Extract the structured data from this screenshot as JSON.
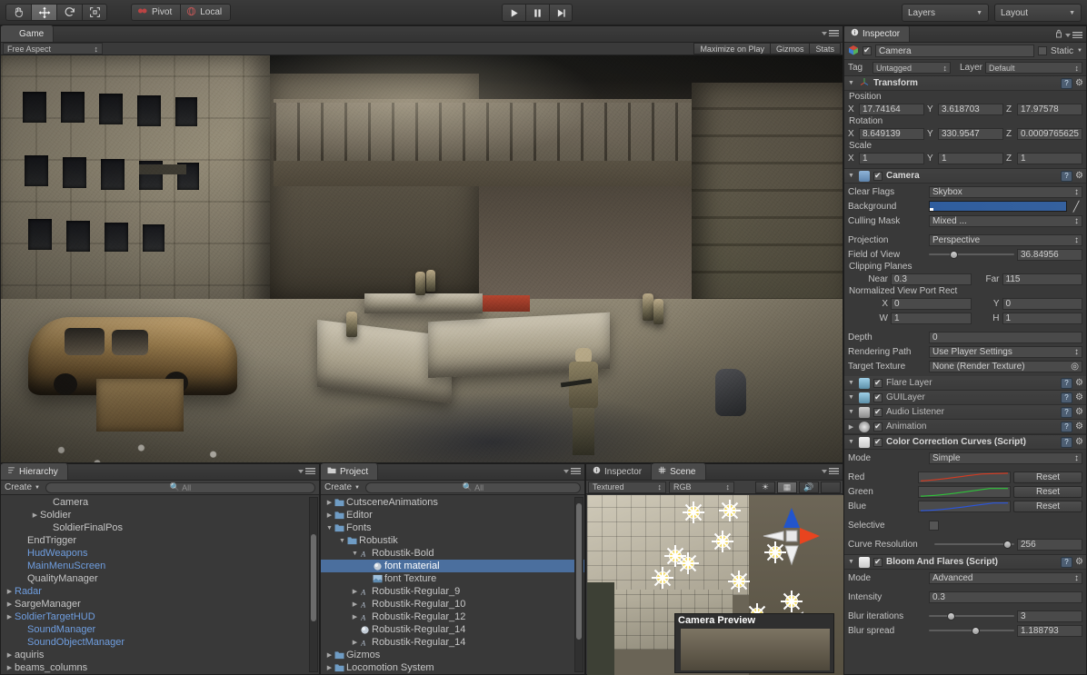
{
  "toolbar": {
    "tools": [
      {
        "name": "hand-tool",
        "icon": "hand",
        "active": false
      },
      {
        "name": "move-tool",
        "icon": "move",
        "active": true
      },
      {
        "name": "rotate-tool",
        "icon": "rotate",
        "active": false
      },
      {
        "name": "scale-tool",
        "icon": "scale",
        "active": false
      }
    ],
    "pivot_label": "Pivot",
    "local_label": "Local",
    "play_label": "▶",
    "pause_label": "❙❙",
    "step_label": "▶❙",
    "layers_label": "Layers",
    "layout_label": "Layout"
  },
  "game_view": {
    "tab_label": "Game",
    "aspect_label": "Free Aspect",
    "maximize_label": "Maximize on Play",
    "gizmos_label": "Gizmos",
    "stats_label": "Stats"
  },
  "hierarchy": {
    "tab_label": "Hierarchy",
    "create_label": "Create",
    "search_placeholder": "All",
    "items": [
      {
        "label": "Camera",
        "indent": 3,
        "arrow": false,
        "prefab": false,
        "selected": false
      },
      {
        "label": "Soldier",
        "indent": 2,
        "arrow": true,
        "prefab": false,
        "selected": false
      },
      {
        "label": "SoldierFinalPos",
        "indent": 3,
        "arrow": false,
        "prefab": false,
        "selected": false
      },
      {
        "label": "EndTrigger",
        "indent": 1,
        "arrow": false,
        "prefab": false,
        "selected": false
      },
      {
        "label": "HudWeapons",
        "indent": 1,
        "arrow": false,
        "prefab": true,
        "selected": false
      },
      {
        "label": "MainMenuScreen",
        "indent": 1,
        "arrow": false,
        "prefab": true,
        "selected": false
      },
      {
        "label": "QualityManager",
        "indent": 1,
        "arrow": false,
        "prefab": false,
        "selected": false
      },
      {
        "label": "Radar",
        "indent": 0,
        "arrow": true,
        "prefab": true,
        "selected": false
      },
      {
        "label": "SargeManager",
        "indent": 0,
        "arrow": true,
        "prefab": false,
        "selected": false
      },
      {
        "label": "SoldierTargetHUD",
        "indent": 0,
        "arrow": true,
        "prefab": true,
        "selected": false
      },
      {
        "label": "SoundManager",
        "indent": 1,
        "arrow": false,
        "prefab": true,
        "selected": false
      },
      {
        "label": "SoundObjectManager",
        "indent": 1,
        "arrow": false,
        "prefab": true,
        "selected": false
      },
      {
        "label": "aquiris",
        "indent": -1,
        "arrow": true,
        "prefab": false,
        "selected": false
      },
      {
        "label": "beams_columns",
        "indent": -1,
        "arrow": true,
        "prefab": false,
        "selected": false
      }
    ]
  },
  "project": {
    "tab_label": "Project",
    "create_label": "Create",
    "search_placeholder": "All",
    "items": [
      {
        "label": "CutsceneAnimations",
        "indent": 0,
        "arrow": "right",
        "icon": "folder",
        "selected": false
      },
      {
        "label": "Editor",
        "indent": 0,
        "arrow": "right",
        "icon": "folder",
        "selected": false
      },
      {
        "label": "Fonts",
        "indent": 0,
        "arrow": "down",
        "icon": "folder",
        "selected": false
      },
      {
        "label": "Robustik",
        "indent": 1,
        "arrow": "down",
        "icon": "folder",
        "selected": false
      },
      {
        "label": "Robustik-Bold",
        "indent": 2,
        "arrow": "down",
        "icon": "font",
        "selected": false
      },
      {
        "label": "font material",
        "indent": 3,
        "arrow": "none",
        "icon": "material",
        "selected": true
      },
      {
        "label": "font Texture",
        "indent": 3,
        "arrow": "none",
        "icon": "texture",
        "selected": false
      },
      {
        "label": "Robustik-Regular_9",
        "indent": 2,
        "arrow": "right",
        "icon": "font",
        "selected": false
      },
      {
        "label": "Robustik-Regular_10",
        "indent": 2,
        "arrow": "right",
        "icon": "font",
        "selected": false
      },
      {
        "label": "Robustik-Regular_12",
        "indent": 2,
        "arrow": "right",
        "icon": "font",
        "selected": false
      },
      {
        "label": "Robustik-Regular_14",
        "indent": 2,
        "arrow": "none",
        "icon": "material",
        "selected": false
      },
      {
        "label": "Robustik-Regular_14",
        "indent": 2,
        "arrow": "right",
        "icon": "font",
        "selected": false
      },
      {
        "label": "Gizmos",
        "indent": 0,
        "arrow": "right",
        "icon": "folder",
        "selected": false
      },
      {
        "label": "Locomotion System",
        "indent": 0,
        "arrow": "right",
        "icon": "folder",
        "selected": false
      }
    ]
  },
  "preview": {
    "inspector_tab_label": "Inspector",
    "scene_tab_label": "Scene",
    "draw_mode_label": "Textured",
    "color_mode_label": "RGB",
    "light_icon": "sun-icon",
    "fx_icon": "image-icon",
    "audio_icon": "speaker-icon",
    "camera_preview_label": "Camera Preview"
  },
  "inspector": {
    "tab_label": "Inspector",
    "object_name": "Camera",
    "object_enabled": true,
    "static_label": "Static",
    "tag_label": "Tag",
    "tag_value": "Untagged",
    "layer_label": "Layer",
    "layer_value": "Default",
    "transform": {
      "title": "Transform",
      "position_label": "Position",
      "position": {
        "x": "17.74164",
        "y": "3.618703",
        "z": "17.97578"
      },
      "rotation_label": "Rotation",
      "rotation": {
        "x": "8.649139",
        "y": "330.9547",
        "z": "0.0009765625"
      },
      "scale_label": "Scale",
      "scale": {
        "x": "1",
        "y": "1",
        "z": "1"
      }
    },
    "camera": {
      "title": "Camera",
      "enabled": true,
      "clear_flags_label": "Clear Flags",
      "clear_flags_value": "Skybox",
      "background_label": "Background",
      "background_color": "#32609e",
      "culling_mask_label": "Culling Mask",
      "culling_mask_value": "Mixed ...",
      "projection_label": "Projection",
      "projection_value": "Perspective",
      "fov_label": "Field of View",
      "fov_value": "36.84956",
      "fov_percent": 27,
      "clipping_label": "Clipping Planes",
      "near_label": "Near",
      "near_value": "0.3",
      "far_label": "Far",
      "far_value": "115",
      "viewport_label": "Normalized View Port Rect",
      "viewport": {
        "x": "0",
        "y": "0",
        "w": "1",
        "h": "1"
      },
      "depth_label": "Depth",
      "depth_value": "0",
      "rendering_path_label": "Rendering Path",
      "rendering_path_value": "Use Player Settings",
      "target_texture_label": "Target Texture",
      "target_texture_value": "None (Render Texture)"
    },
    "flare_layer": {
      "title": "Flare Layer",
      "enabled": true
    },
    "gui_layer": {
      "title": "GUILayer",
      "enabled": true
    },
    "audio_listener": {
      "title": "Audio Listener",
      "enabled": true
    },
    "animation": {
      "title": "Animation",
      "enabled": true
    },
    "color_correction": {
      "title": "Color Correction Curves (Script)",
      "enabled": true,
      "mode_label": "Mode",
      "mode_value": "Simple",
      "red_label": "Red",
      "green_label": "Green",
      "blue_label": "Blue",
      "reset_label": "Reset",
      "selective_label": "Selective",
      "selective_checked": false,
      "curve_resolution_label": "Curve Resolution",
      "curve_resolution_value": "256",
      "curve_resolution_percent": 96
    },
    "bloom": {
      "title": "Bloom And Flares (Script)",
      "enabled": true,
      "mode_label": "Mode",
      "mode_value": "Advanced",
      "intensity_label": "Intensity",
      "intensity_value": "0.3",
      "blur_iterations_label": "Blur iterations",
      "blur_iterations_value": "3",
      "blur_iterations_percent": 23,
      "blur_spread_label": "Blur spread",
      "blur_spread_value": "1.188793",
      "blur_spread_percent": 55
    }
  }
}
